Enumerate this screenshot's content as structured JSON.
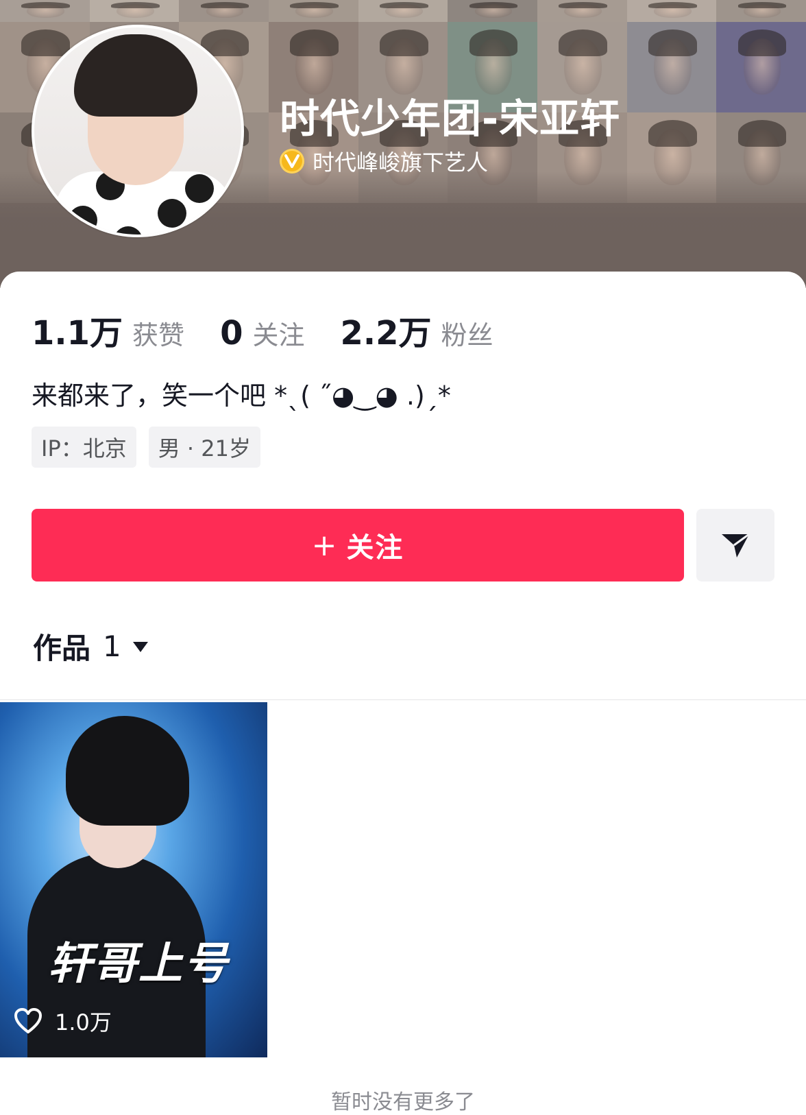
{
  "profile": {
    "name": "时代少年团-宋亚轩",
    "verification": "时代峰峻旗下艺人",
    "bio": "来都来了，笑一个吧 *ˎ( ˝◕‿◕ .)ˏ*"
  },
  "stats": [
    {
      "value": "1.1万",
      "label": "获赞"
    },
    {
      "value": "0",
      "label": "关注"
    },
    {
      "value": "2.2万",
      "label": "粉丝"
    }
  ],
  "tags": [
    "IP：北京",
    "男 · 21岁"
  ],
  "actions": {
    "follow_plus": "+",
    "follow_label": "关注"
  },
  "works": {
    "label": "作品",
    "count": "1"
  },
  "videos": [
    {
      "title": "轩哥上号",
      "likes": "1.0万"
    }
  ],
  "footer": {
    "no_more": "暂时没有更多了"
  },
  "colors": {
    "accent": "#fe2c55",
    "badge": "#f6b81c"
  },
  "icons": [
    "verified-v-icon",
    "paper-plane-icon",
    "caret-down-icon",
    "heart-icon"
  ]
}
